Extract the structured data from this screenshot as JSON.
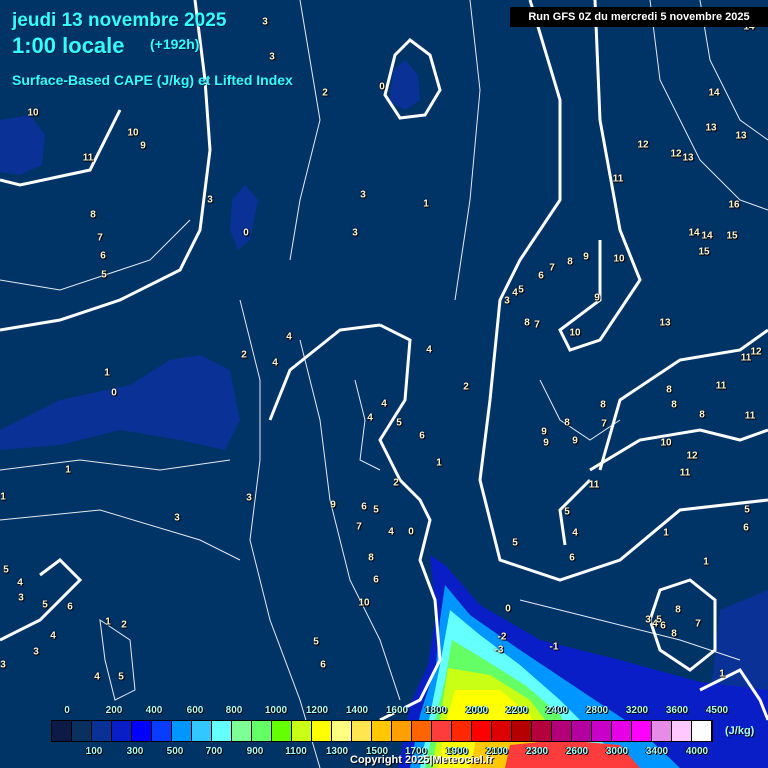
{
  "header": {
    "date": "jeudi 13 novembre 2025",
    "time": "1:00 locale",
    "lead": "(+192h)",
    "parameter": "Surface-Based CAPE (J/kg) et Lifted Index",
    "run": "Run GFS 0Z du mercredi 5 novembre 2025"
  },
  "legend": {
    "unit": "(J/kg)",
    "top_labels": [
      "0",
      "200",
      "400",
      "600",
      "800",
      "1000",
      "1200",
      "1400",
      "1600",
      "1800",
      "2000",
      "2200",
      "2400",
      "2800",
      "3200",
      "3600",
      "4500"
    ],
    "bottom_labels": [
      "100",
      "300",
      "500",
      "700",
      "900",
      "1100",
      "1300",
      "1500",
      "1700",
      "1900",
      "2100",
      "2300",
      "2600",
      "3000",
      "3400",
      "4000"
    ],
    "colors": [
      "#0c1a45",
      "#0a3060",
      "#0a3296",
      "#0a1ec8",
      "#0000ff",
      "#0a3cff",
      "#0096ff",
      "#32c8ff",
      "#64ffff",
      "#7dff96",
      "#64ff64",
      "#64ff00",
      "#c8ff14",
      "#ffff00",
      "#ffff82",
      "#ffe650",
      "#ffc800",
      "#ffa000",
      "#ff6400",
      "#ff3c3c",
      "#ff2800",
      "#ff0000",
      "#dc0000",
      "#b40000",
      "#b4003c",
      "#b40078",
      "#b400a0",
      "#c800c8",
      "#e600e6",
      "#ff00ff",
      "#e68ce6",
      "#ffc8ff",
      "#ffffff"
    ]
  },
  "contour_labels": [
    "3",
    "3",
    "2",
    "0",
    "10",
    "10",
    "9",
    "11",
    "8",
    "7",
    "6",
    "5",
    "3",
    "0",
    "3",
    "3",
    "1",
    "14",
    "14",
    "13",
    "13",
    "12",
    "12",
    "13",
    "11",
    "16",
    "14",
    "14",
    "15",
    "15",
    "10",
    "9",
    "8",
    "7",
    "6",
    "5",
    "4",
    "3",
    "9",
    "8",
    "7",
    "10",
    "13",
    "12",
    "11",
    "11",
    "8",
    "8",
    "8",
    "11",
    "8",
    "8",
    "7",
    "9",
    "9",
    "9",
    "10",
    "12",
    "11",
    "11",
    "5",
    "4",
    "1",
    "6",
    "5",
    "5",
    "6",
    "4",
    "4",
    "2",
    "1",
    "0",
    "4",
    "2",
    "4",
    "4",
    "5",
    "6",
    "1",
    "2",
    "9",
    "6",
    "5",
    "7",
    "4",
    "0",
    "8",
    "6",
    "10",
    "1",
    "1",
    "3",
    "3",
    "5",
    "4",
    "3",
    "5",
    "6",
    "1",
    "2",
    "4",
    "3",
    "3",
    "4",
    "5",
    "5",
    "6",
    "0",
    "-2",
    "-3",
    "-1",
    "3",
    "4",
    "5",
    "6",
    "8",
    "7",
    "8",
    "1",
    "1"
  ],
  "copyright": "Copyright 2025|Meteociel.fr"
}
